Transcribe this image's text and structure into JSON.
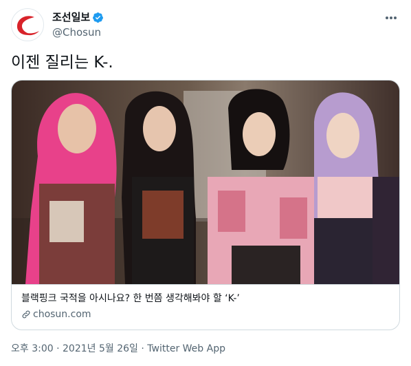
{
  "header": {
    "display_name": "조선일보",
    "handle": "@Chosun",
    "avatar_logo": "chosun-swoosh-logo",
    "verified_icon": "verified-badge-icon",
    "more_icon": "more-horizontal-icon"
  },
  "tweet": {
    "text": "이젠 질리는 K-."
  },
  "card": {
    "image_description_icon": "photo",
    "title": "블랙핑크 국적을 아시나요? 한 번쯤 생각해봐야 할 ‘K-’",
    "domain": "chosun.com",
    "link_icon": "link-icon"
  },
  "meta": {
    "time": "오후 3:00",
    "separator1": " · ",
    "date": "2021년 5월 26일",
    "separator2": " · ",
    "source": "Twitter Web App"
  },
  "colors": {
    "text": "#0f1419",
    "secondary": "#536471",
    "verified": "#1d9bf0",
    "brand_red": "#d8232a",
    "border": "#cfd9de"
  }
}
